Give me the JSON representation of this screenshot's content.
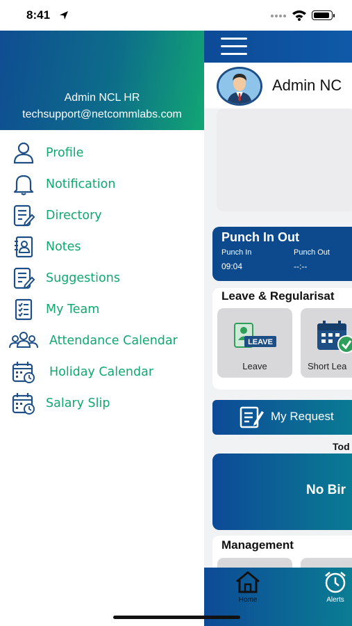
{
  "status_bar": {
    "time": "8:41"
  },
  "drawer": {
    "user_name": "Admin NCL HR",
    "email": "techsupport@netcommlabs.com",
    "items": [
      {
        "label": "Profile",
        "icon": "person-icon"
      },
      {
        "label": "Notification",
        "icon": "bell-icon"
      },
      {
        "label": "Directory",
        "icon": "document-edit-icon"
      },
      {
        "label": "Notes",
        "icon": "contact-book-icon"
      },
      {
        "label": "Suggestions",
        "icon": "document-edit-icon"
      },
      {
        "label": "My Team",
        "icon": "checklist-icon"
      },
      {
        "label": "Attendance Calendar",
        "icon": "group-icon"
      },
      {
        "label": "Holiday Calendar",
        "icon": "calendar-clock-icon"
      },
      {
        "label": "Salary Slip",
        "icon": "calendar-clock-icon"
      }
    ],
    "accent_color": "#0fa86f"
  },
  "app": {
    "user_name": "Admin NC",
    "punch": {
      "title": "Punch In Out",
      "in_label": "Punch In",
      "out_label": "Punch Out",
      "in_value": "09:04",
      "out_value": "--:--"
    },
    "leave_section": {
      "title": "Leave & Regularisat",
      "tiles": [
        {
          "label": "Leave",
          "badge": "LEAVE"
        },
        {
          "label": "Short Lea"
        }
      ]
    },
    "my_request": "My Request",
    "today_label": "Tod",
    "birthday_text": "No Bir",
    "management_title": "Management",
    "nav": {
      "home": "Home",
      "alerts": "Alerts"
    },
    "primary_color": "#0d4a97"
  }
}
